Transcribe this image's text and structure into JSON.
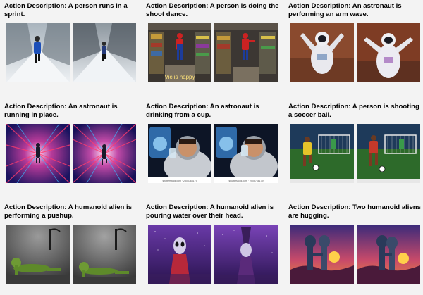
{
  "panels": [
    {
      "label": "Action Description:",
      "desc": "A person runs in a sprint."
    },
    {
      "label": "Action Description:",
      "desc": "A person is doing the shoot dance.",
      "overlay_text": "Vic is happy"
    },
    {
      "label": "Action Description:",
      "desc": "An astronaut is performing an arm wave."
    },
    {
      "label": "Action Description:",
      "desc": "An astronaut is running in place."
    },
    {
      "label": "Action Description:",
      "desc": "An astronaut is drinking from a cup.",
      "watermark": "shutterstock.com · 2505768179"
    },
    {
      "label": "Action Description:",
      "desc": "A person is shooting a soccer ball."
    },
    {
      "label": "Action Description:",
      "desc": "A humanoid alien is performing a pushup."
    },
    {
      "label": "Action Description:",
      "desc": "A humanoid alien is pouring water over their head."
    },
    {
      "label": "Action Description:",
      "desc": "Two humanoid aliens are hugging."
    }
  ],
  "colors": {
    "background": "#f3f3f3",
    "caption": "#000000"
  }
}
